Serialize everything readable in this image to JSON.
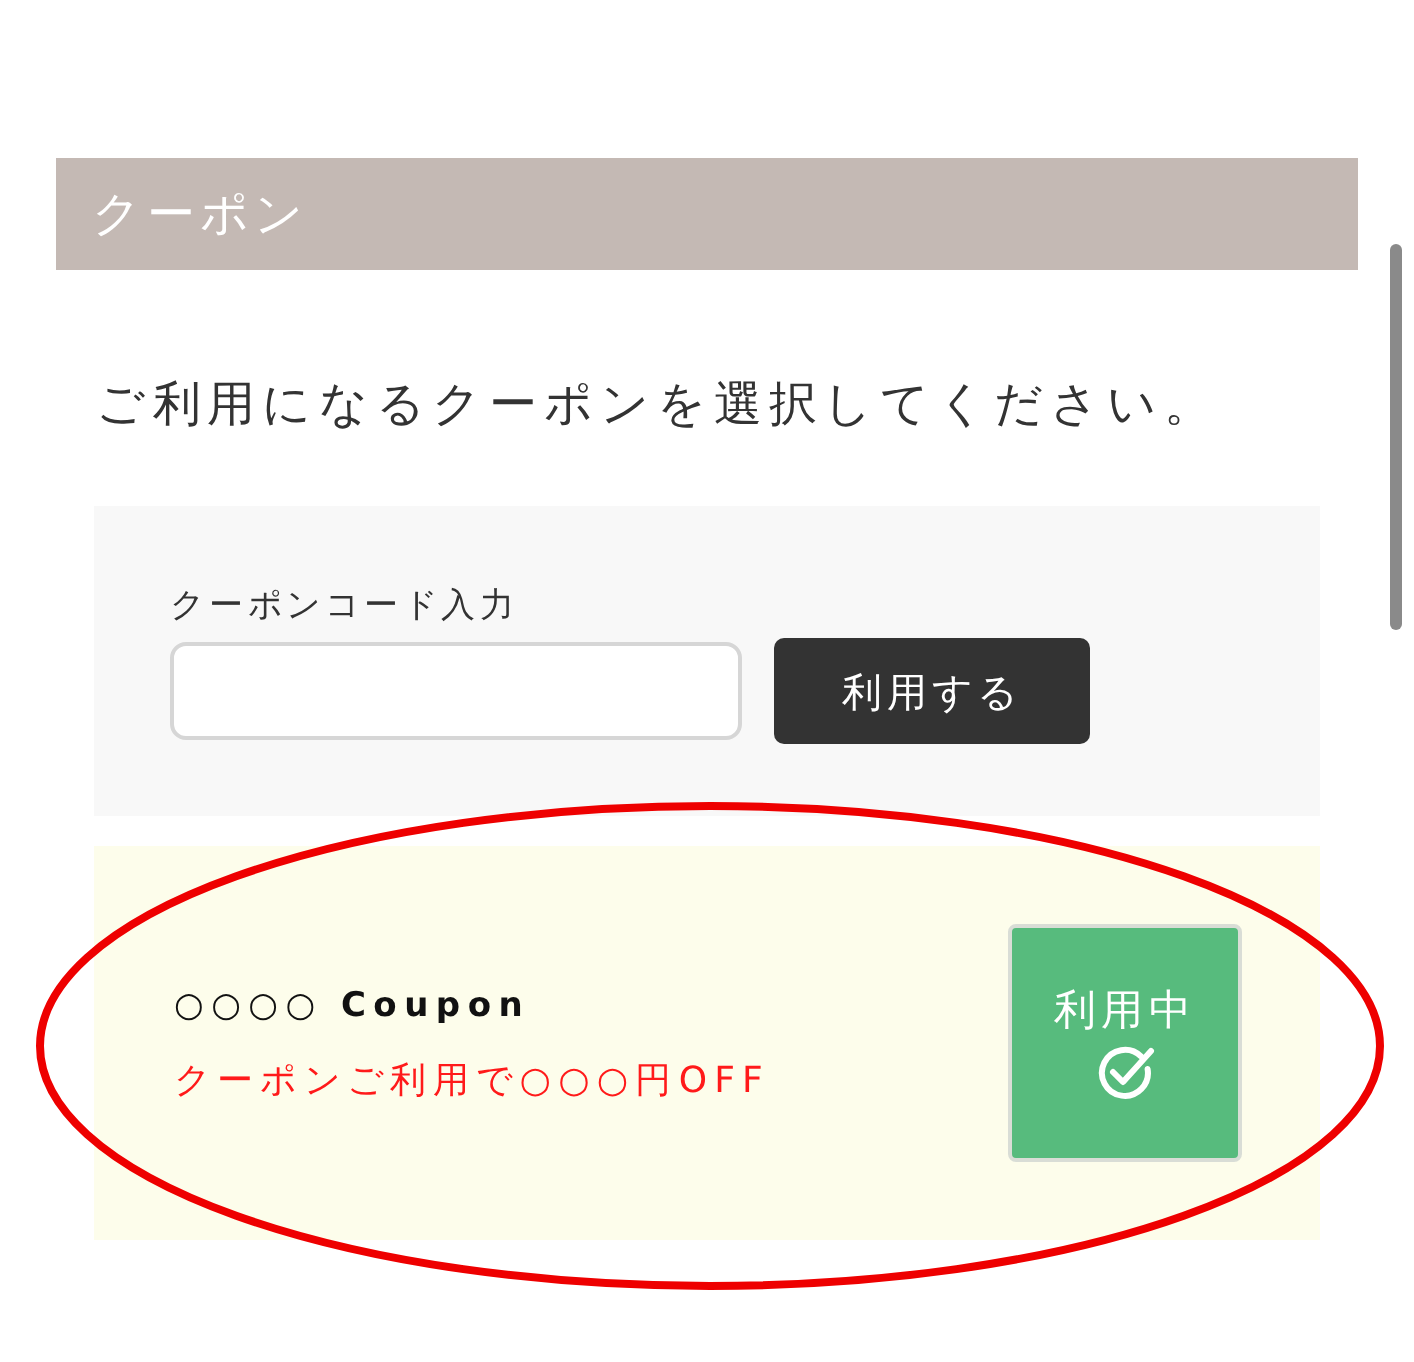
{
  "header": {
    "title": "クーポン"
  },
  "instruction": "ご利用になるクーポンを選択してください。",
  "code_entry": {
    "label": "クーポンコード入力",
    "submit_button": "利用する"
  },
  "coupons": [
    {
      "title": "○○○○ **Coupon**",
      "description": "クーポンご利用で○○○円OFF",
      "status_button": "利用中",
      "selected": true,
      "highlighted": true
    }
  ]
}
